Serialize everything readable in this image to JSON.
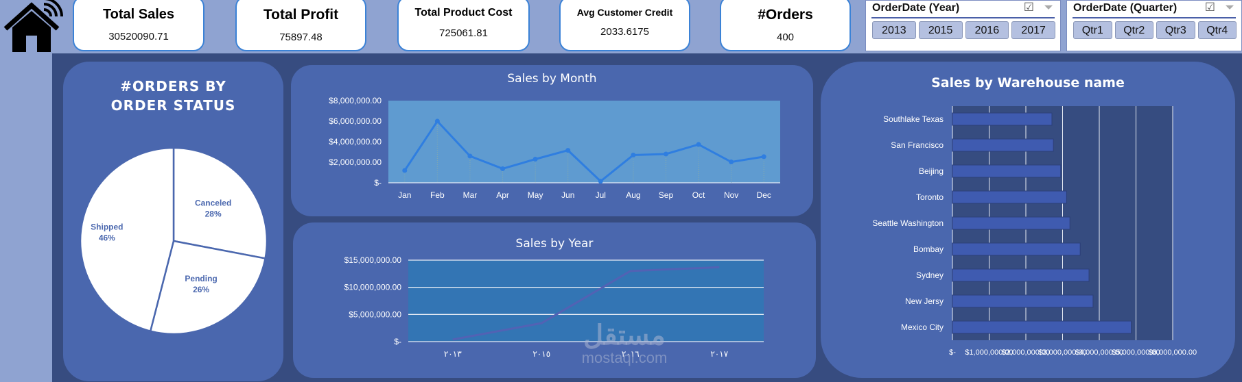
{
  "kpis": [
    {
      "title": "Total Sales",
      "value": "30520090.71"
    },
    {
      "title": "Total Profit",
      "value": "75897.48"
    },
    {
      "title": "Total Product  Cost",
      "value": "725061.81"
    },
    {
      "title": "Avg  Customer Credit",
      "value": "2033.6175"
    },
    {
      "title": "#Orders",
      "value": "400"
    }
  ],
  "slicers": [
    {
      "title": "OrderDate (Year)",
      "items": [
        "2013",
        "2015",
        "2016",
        "2017"
      ]
    },
    {
      "title": "OrderDate (Quarter)",
      "items": [
        "Qtr1",
        "Qtr2",
        "Qtr3",
        "Qtr4"
      ]
    }
  ],
  "icons": {
    "home": "home-wifi-icon",
    "multiselect": "multi-select-icon",
    "clear_filter": "clear-filter-icon"
  },
  "colors": {
    "card": "#4a67ae",
    "background": "#374c80",
    "topbar": "#8fa3d1",
    "month_plot": "#5f9bd0",
    "month_line": "#2f7ee0",
    "year_plot": "#3375b4",
    "year_line": "#5262b4",
    "bar": "#3f5bb0"
  },
  "watermark": {
    "arabic": "مستقل",
    "latin": "mostaql.com"
  },
  "chart_data": [
    {
      "type": "pie",
      "title": "#ORDERS BY ORDER STATUS",
      "categories": [
        "Canceled",
        "Pending",
        "Shipped"
      ],
      "values": [
        28,
        26,
        46
      ],
      "labels": [
        "28%",
        "26%",
        "46%"
      ]
    },
    {
      "type": "line",
      "title": "Sales by Month",
      "categories": [
        "Jan",
        "Feb",
        "Mar",
        "Apr",
        "May",
        "Jun",
        "Jul",
        "Aug",
        "Sep",
        "Oct",
        "Nov",
        "Dec"
      ],
      "values": [
        1200000,
        6000000,
        2600000,
        1370000,
        2300000,
        3160000,
        150000,
        2700000,
        2800000,
        3730000,
        2030000,
        2540000
      ],
      "ylim": [
        0,
        8000000
      ],
      "yticks": [
        "$-",
        "$2,000,000.00",
        "$4,000,000.00",
        "$6,000,000.00",
        "$8,000,000.00"
      ]
    },
    {
      "type": "line",
      "title": "Sales by Year",
      "categories": [
        "٢٠١٣",
        "٢٠١٥",
        "٢٠١٦",
        "٢٠١٧"
      ],
      "values": [
        380000,
        3400000,
        13000000,
        13700000
      ],
      "ylim": [
        0,
        15000000
      ],
      "yticks": [
        "$-",
        "$5,000,000.00",
        "$10,000,000.00",
        "$15,000,000.00"
      ],
      "grid": true
    },
    {
      "type": "bar",
      "orientation": "horizontal",
      "title": "Sales by Warehouse name",
      "categories": [
        "Southlake Texas",
        "San Francisco",
        "Beijing",
        "Toronto",
        "Seattle Washington",
        "Bombay",
        "Sydney",
        "New Jersy",
        "Mexico City"
      ],
      "values": [
        2710000,
        2750000,
        2950000,
        3110000,
        3200000,
        3480000,
        3720000,
        3830000,
        4870000
      ],
      "xlim": [
        0,
        6000000
      ],
      "xticks": [
        "$-",
        "$1,000,000.00",
        "$2,000,000.00",
        "$3,000,000.00",
        "$4,000,000.00",
        "$5,000,000.00",
        "$6,000,000.00"
      ],
      "grid": true
    }
  ]
}
